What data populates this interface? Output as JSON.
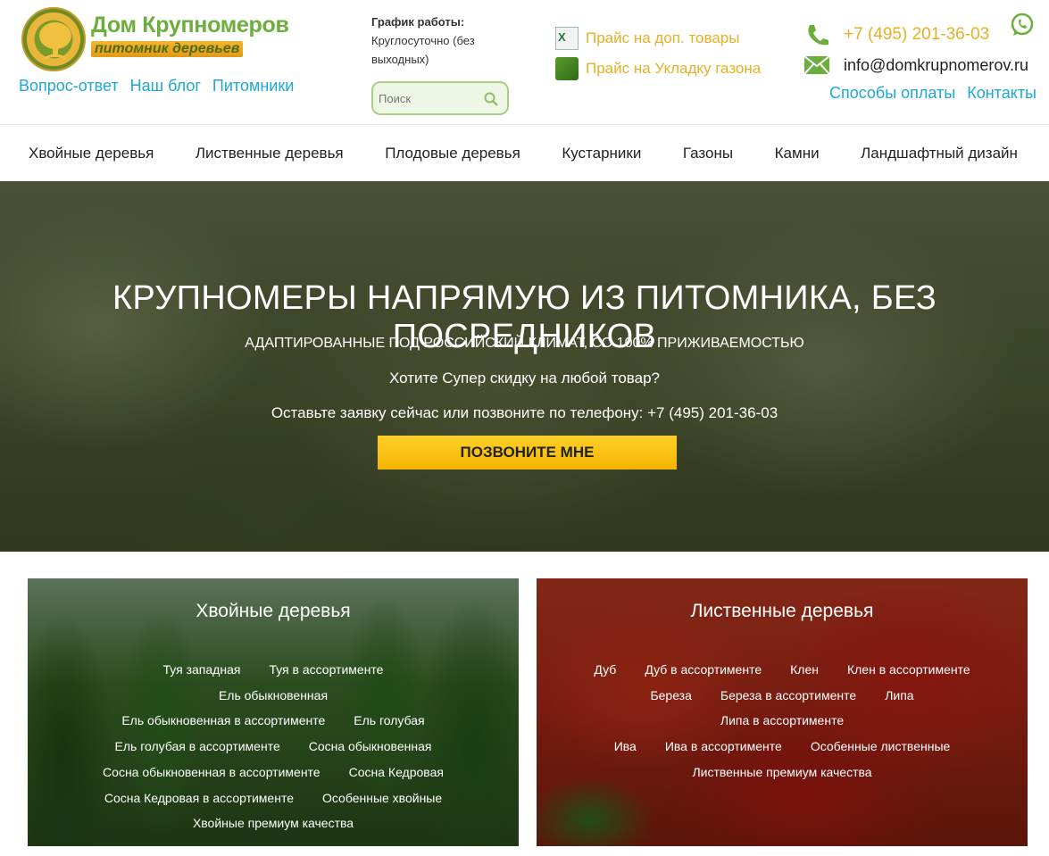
{
  "brand": {
    "title": "Дом Крупномеров",
    "subtitle": "питомник деревьев"
  },
  "top_links": [
    "Вопрос-ответ",
    "Наш блог",
    "Питомники"
  ],
  "schedule": {
    "label": "График работы:",
    "value": "Круглосуточно (без выходных)"
  },
  "search": {
    "placeholder": "Поиск"
  },
  "prices": {
    "extra_goods": "Прайс на доп. товары",
    "lawn": "Прайс на Укладку газона"
  },
  "contacts": {
    "phone": "+7 (495) 201-36-03",
    "email": "info@domkrupnomerov.ru"
  },
  "pay_links": [
    "Способы оплаты",
    "Контакты"
  ],
  "nav": [
    "Хвойные деревья",
    "Лиственные деревья",
    "Плодовые деревья",
    "Кустарники",
    "Газоны",
    "Камни",
    "Ландшафтный дизайн"
  ],
  "hero": {
    "title": "КРУПНОМЕРЫ НАПРЯМУЮ ИЗ ПИТОМНИКА, БЕЗ ПОСРЕДНИКОВ",
    "subtitle": "АДАПТИРОВАННЫЕ ПОД РОССИЙСКИЙ КЛИМАТ, СО 100% ПРИЖИВАЕМОСТЬЮ",
    "question": "Хотите Супер скидку на любой товар?",
    "call_text": "Оставьте заявку сейчас или позвоните по телефону: +7 (495) 201-36-03",
    "cta": "ПОЗВОНИТЕ МНЕ"
  },
  "cards": {
    "conifer": {
      "title": "Хвойные деревья",
      "links": [
        "Туя западная",
        "Туя в ассортименте",
        "Ель обыкновенная",
        "Ель обыкновенная в ассортименте",
        "Ель голубая",
        "Ель голубая в ассортименте",
        "Сосна обыкновенная",
        "Сосна обыкновенная в ассортименте",
        "Сосна Кедровая",
        "Сосна Кедровая в ассортименте",
        "Особенные хвойные",
        "Хвойные премиум качества"
      ]
    },
    "leaf": {
      "title": "Лиственные деревья",
      "links": [
        "Дуб",
        "Дуб в ассортименте",
        "Клен",
        "Клен в ассортименте",
        "Береза",
        "Береза в ассортименте",
        "Липа",
        "Липа в ассортименте",
        "Ива",
        "Ива в ассортименте",
        "Особенные лиственные",
        "Лиственные премиум качества"
      ]
    }
  },
  "colors": {
    "brand_green": "#6cae3b",
    "link_blue": "#1fa7d4",
    "accent_yellow": "#e7b024",
    "cta_yellow": "#f4b400"
  }
}
